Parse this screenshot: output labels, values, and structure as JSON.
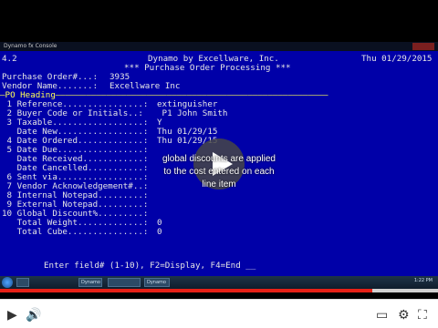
{
  "window": {
    "title": "Dynamo fx Console"
  },
  "terminal": {
    "version": "4.2",
    "app_title": "Dynamo by Excellware, Inc.",
    "date": "Thu 01/29/2015",
    "po_label": "Purchase Order#...:",
    "po_value": "3935",
    "screen_title": "*** Purchase Order Processing ***",
    "vendor_label": "Vendor Name.......:",
    "vendor_value": "Excellware Inc",
    "section": "PO Heading",
    "fields": [
      {
        "label": " 1 Reference................:",
        "value": "extinguisher"
      },
      {
        "label": " 2 Buyer Code or Initials..:",
        "value": " P1 John Smith"
      },
      {
        "label": " 3 Taxable..................:",
        "value": "Y"
      },
      {
        "label": "   Date New.................:",
        "value": "Thu 01/29/15"
      },
      {
        "label": " 4 Date Ordered.............:",
        "value": "Thu 01/29/15"
      },
      {
        "label": " 5 Date Due.................:",
        "value": ""
      },
      {
        "label": "   Date Received............:",
        "value": ""
      },
      {
        "label": "   Date Cancelled...........:",
        "value": ""
      },
      {
        "label": " 6 Sent via.................:",
        "value": ""
      },
      {
        "label": " 7 Vendor Acknowledgement#..:",
        "value": ""
      },
      {
        "label": " 8 Internal Notepad.........:",
        "value": ""
      },
      {
        "label": " 9 External Notepad.........:",
        "value": ""
      },
      {
        "label": "10 Global Discount%.........:",
        "value": ""
      },
      {
        "label": "   Total Weight.............:",
        "value": "0"
      },
      {
        "label": "   Total Cube...............:",
        "value": "0"
      }
    ],
    "prompt": "Enter field# (1-10), F2=Display, F4=End __"
  },
  "overlay": {
    "annotation": "global discounts are applied to the cost entered on each line item"
  },
  "taskbar": {
    "items": [
      "",
      "Dynamo fx",
      "",
      "Dynamo"
    ],
    "clock": "1:22 PM"
  },
  "video": {
    "progress": 0.85
  }
}
